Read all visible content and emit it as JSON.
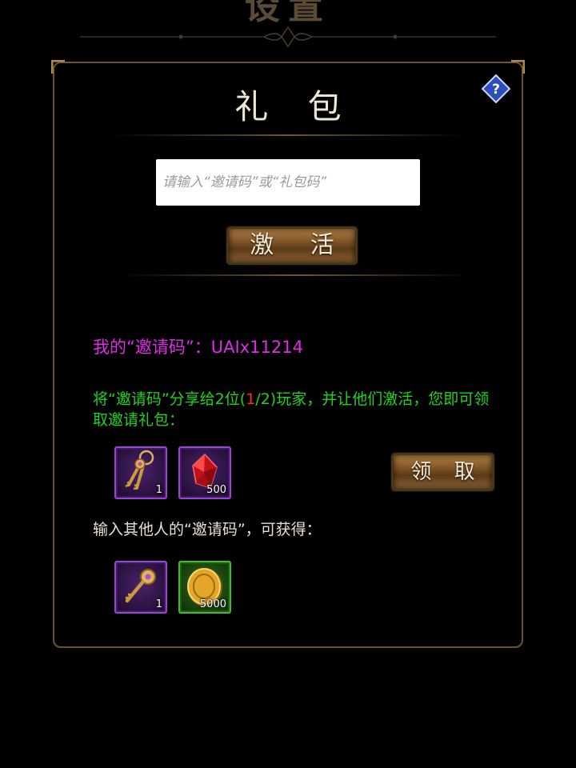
{
  "page": {
    "title": "设置"
  },
  "panel": {
    "title": "礼 包"
  },
  "code_input": {
    "value": "",
    "placeholder": "请输入“邀请码”或“礼包码”"
  },
  "activate_button": {
    "label": "激 活"
  },
  "my_code": {
    "label": "我的“邀请码”：",
    "value": "UAIx11214"
  },
  "share": {
    "text_before": "将“邀请码”分享给2位(",
    "progress_current": "1",
    "text_after": "/2)玩家，并让他们激活，您即可领取邀请礼包："
  },
  "invite_rewards": [
    {
      "icon": "keyring-icon",
      "count": "1"
    },
    {
      "icon": "red-crystal-icon",
      "count": "500"
    }
  ],
  "claim_button": {
    "label": "领 取"
  },
  "other_code": {
    "text": "输入其他人的“邀请码”，可获得："
  },
  "other_rewards": [
    {
      "icon": "key-icon",
      "count": "1"
    },
    {
      "icon": "gold-coin-icon",
      "count": "5000"
    }
  ],
  "colors": {
    "my_code": "#e02ce8",
    "share_text": "#1fd31f",
    "progress_highlight": "#ff2a2a",
    "panel_border": "#6a5331",
    "button_gold": "#8a6235"
  }
}
